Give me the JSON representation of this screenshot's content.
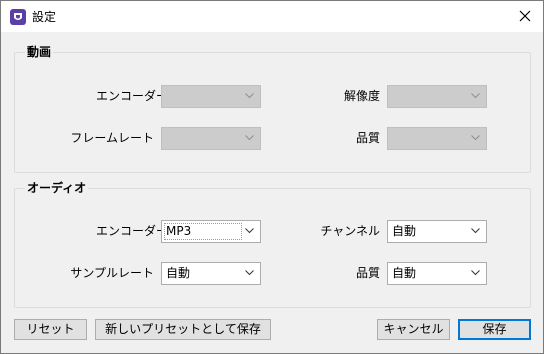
{
  "window": {
    "title": "設定",
    "accent": "#0078d7",
    "icon": "app-icon",
    "close_icon": "close-icon"
  },
  "video": {
    "legend": "動画",
    "encoder_label": "エンコーダー",
    "encoder_value": "",
    "resolution_label": "解像度",
    "resolution_value": "",
    "framerate_label": "フレームレート",
    "framerate_value": "",
    "quality_label": "品質",
    "quality_value": ""
  },
  "audio": {
    "legend": "オーディオ",
    "encoder_label": "エンコーダー",
    "encoder_value": "MP3",
    "channel_label": "チャンネル",
    "channel_value": "自動",
    "samplerate_label": "サンプルレート",
    "samplerate_value": "自動",
    "quality_label": "品質",
    "quality_value": "自動"
  },
  "buttons": {
    "reset": "リセット",
    "save_preset": "新しいプリセットとして保存",
    "cancel": "キャンセル",
    "save": "保存"
  }
}
